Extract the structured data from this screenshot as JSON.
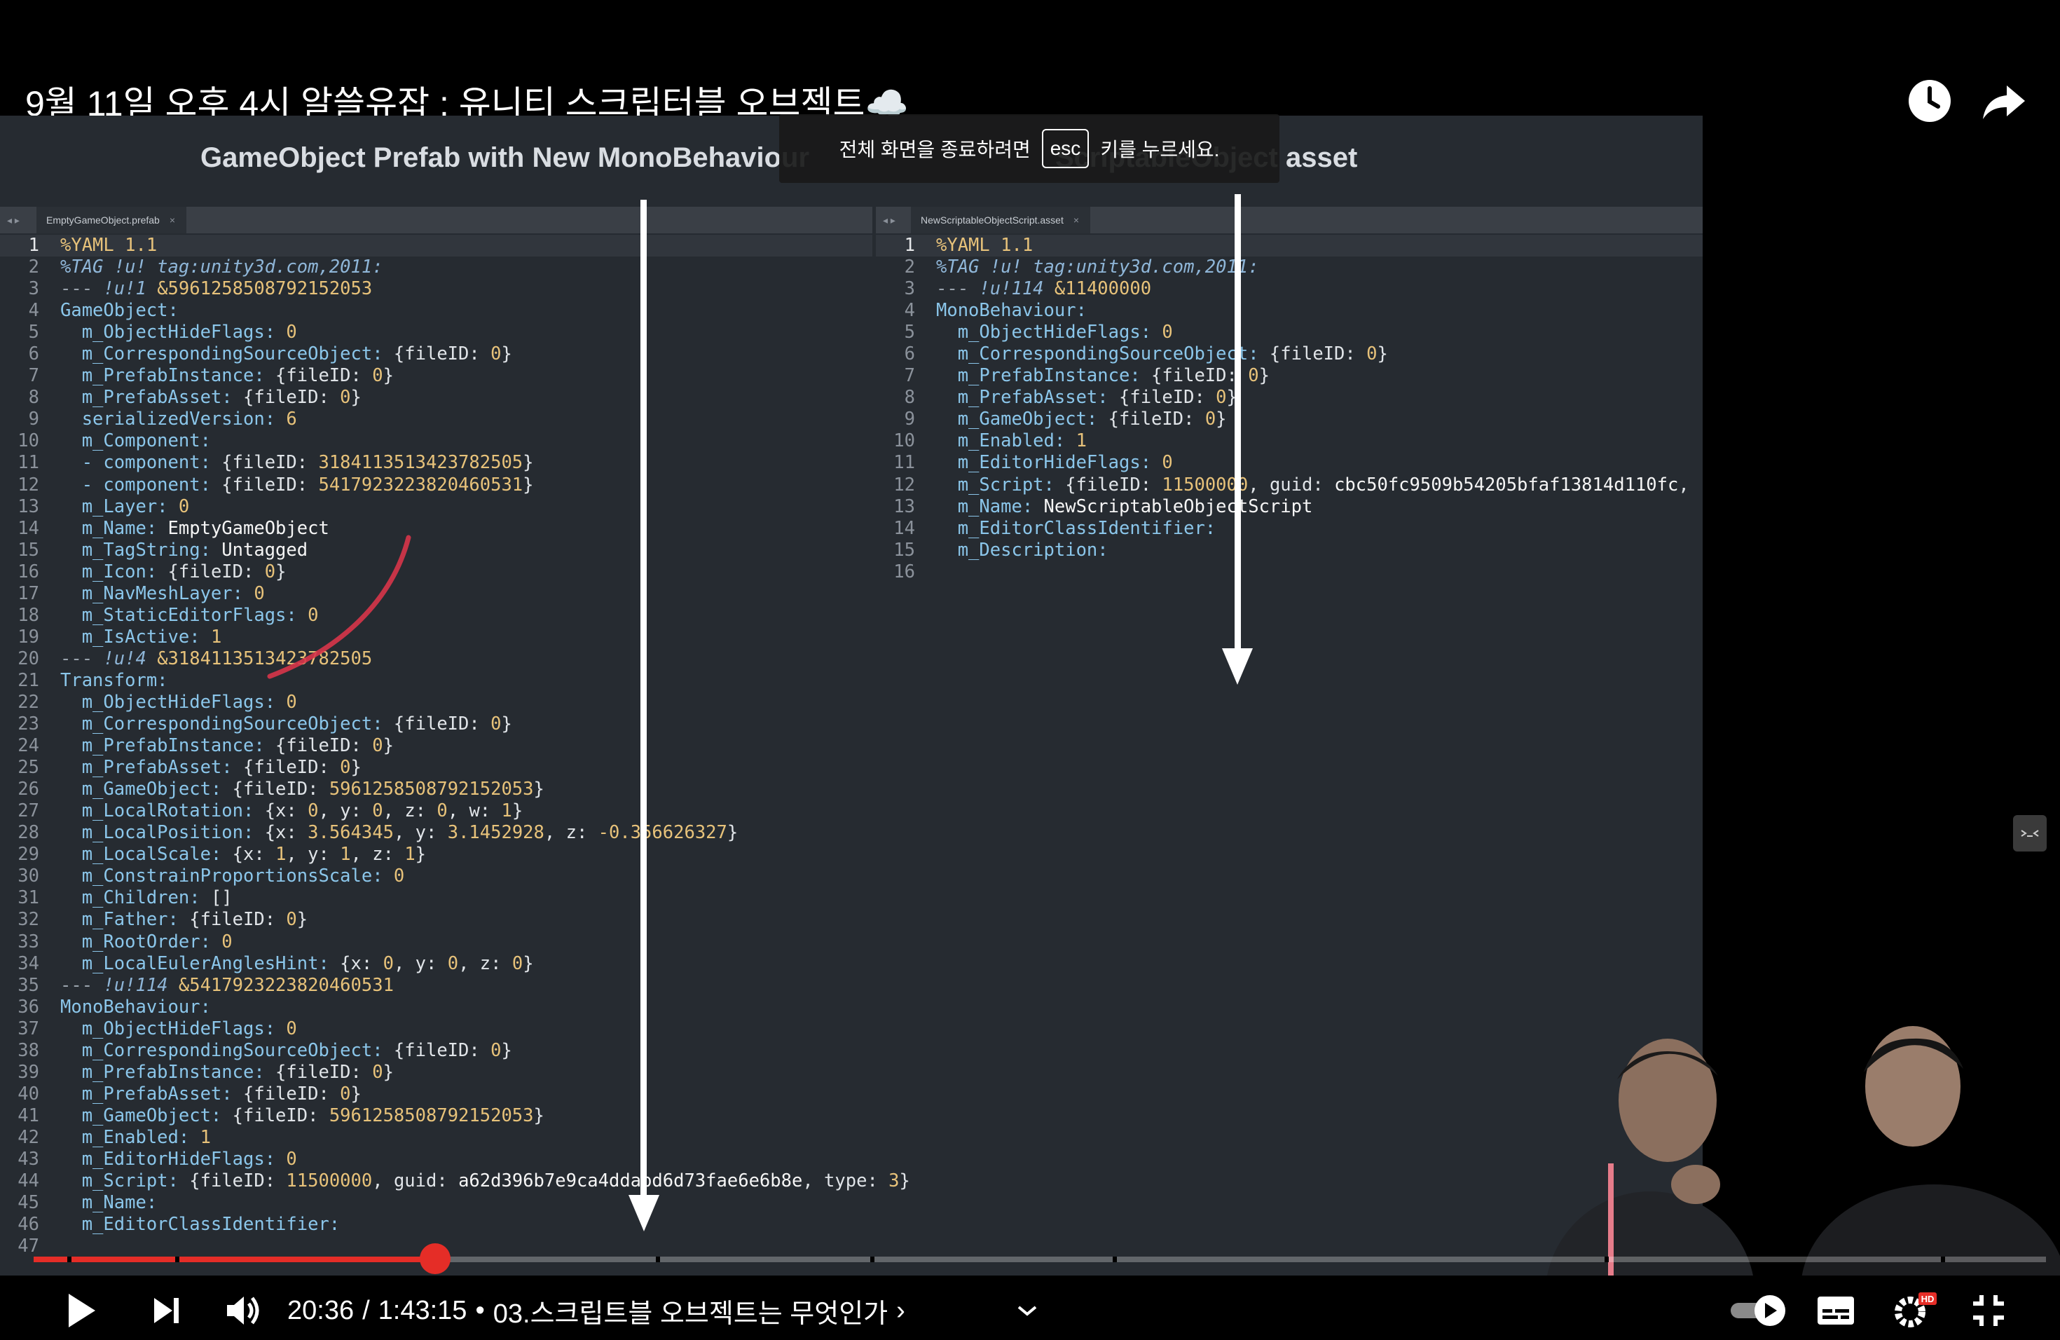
{
  "video": {
    "title": "9월 11일 오후 4시 알쓸유잡 : 유니티 스크립터블 오브젝트☁️"
  },
  "fullscreen_toast": {
    "before": "전체 화면을 종료하려면",
    "key": "esc",
    "after": "키를 누르세요."
  },
  "slide": {
    "left_heading": "GameObject Prefab with New MonoBehaviour",
    "right_heading_tail": "ScriptableObject asset",
    "left_tab": "EmptyGameObject.prefab",
    "right_tab": "NewScriptableObjectScript.asset",
    "tab_close": "×",
    "nav_arrows": "◂ ▸",
    "left_code": [
      [
        [
          "s",
          "%YAML 1.1"
        ]
      ],
      [
        [
          "c",
          "%TAG !u! tag:unity3d.com,2011:"
        ]
      ],
      [
        [
          "g",
          "--- "
        ],
        [
          "c",
          "!u!1 "
        ],
        [
          "s",
          "&5961258508792152053"
        ]
      ],
      [
        [
          "k",
          "GameObject:"
        ]
      ],
      [
        [
          "k",
          "  m_ObjectHideFlags: "
        ],
        [
          "s",
          "0"
        ]
      ],
      [
        [
          "k",
          "  m_CorrespondingSourceObject: "
        ],
        [
          "p",
          "{fileID: "
        ],
        [
          "s",
          "0"
        ],
        [
          "p",
          "}"
        ]
      ],
      [
        [
          "k",
          "  m_PrefabInstance: "
        ],
        [
          "p",
          "{fileID: "
        ],
        [
          "s",
          "0"
        ],
        [
          "p",
          "}"
        ]
      ],
      [
        [
          "k",
          "  m_PrefabAsset: "
        ],
        [
          "p",
          "{fileID: "
        ],
        [
          "s",
          "0"
        ],
        [
          "p",
          "}"
        ]
      ],
      [
        [
          "k",
          "  serializedVersion: "
        ],
        [
          "s",
          "6"
        ]
      ],
      [
        [
          "k",
          "  m_Component:"
        ]
      ],
      [
        [
          "k",
          "  - component: "
        ],
        [
          "p",
          "{fileID: "
        ],
        [
          "s",
          "3184113513423782505"
        ],
        [
          "p",
          "}"
        ]
      ],
      [
        [
          "k",
          "  - component: "
        ],
        [
          "p",
          "{fileID: "
        ],
        [
          "s",
          "5417923223820460531"
        ],
        [
          "p",
          "}"
        ]
      ],
      [
        [
          "k",
          "  m_Layer: "
        ],
        [
          "s",
          "0"
        ]
      ],
      [
        [
          "k",
          "  m_Name: "
        ],
        [
          "w",
          "EmptyGameObject"
        ]
      ],
      [
        [
          "k",
          "  m_TagString: "
        ],
        [
          "w",
          "Untagged"
        ]
      ],
      [
        [
          "k",
          "  m_Icon: "
        ],
        [
          "p",
          "{fileID: "
        ],
        [
          "s",
          "0"
        ],
        [
          "p",
          "}"
        ]
      ],
      [
        [
          "k",
          "  m_NavMeshLayer: "
        ],
        [
          "s",
          "0"
        ]
      ],
      [
        [
          "k",
          "  m_StaticEditorFlags: "
        ],
        [
          "s",
          "0"
        ]
      ],
      [
        [
          "k",
          "  m_IsActive: "
        ],
        [
          "s",
          "1"
        ]
      ],
      [
        [
          "g",
          "--- "
        ],
        [
          "c",
          "!u!4 "
        ],
        [
          "s",
          "&3184113513423782505"
        ]
      ],
      [
        [
          "k",
          "Transform:"
        ]
      ],
      [
        [
          "k",
          "  m_ObjectHideFlags: "
        ],
        [
          "s",
          "0"
        ]
      ],
      [
        [
          "k",
          "  m_CorrespondingSourceObject: "
        ],
        [
          "p",
          "{fileID: "
        ],
        [
          "s",
          "0"
        ],
        [
          "p",
          "}"
        ]
      ],
      [
        [
          "k",
          "  m_PrefabInstance: "
        ],
        [
          "p",
          "{fileID: "
        ],
        [
          "s",
          "0"
        ],
        [
          "p",
          "}"
        ]
      ],
      [
        [
          "k",
          "  m_PrefabAsset: "
        ],
        [
          "p",
          "{fileID: "
        ],
        [
          "s",
          "0"
        ],
        [
          "p",
          "}"
        ]
      ],
      [
        [
          "k",
          "  m_GameObject: "
        ],
        [
          "p",
          "{fileID: "
        ],
        [
          "s",
          "5961258508792152053"
        ],
        [
          "p",
          "}"
        ]
      ],
      [
        [
          "k",
          "  m_LocalRotation: "
        ],
        [
          "p",
          "{x: "
        ],
        [
          "s",
          "0"
        ],
        [
          "p",
          ", y: "
        ],
        [
          "s",
          "0"
        ],
        [
          "p",
          ", z: "
        ],
        [
          "s",
          "0"
        ],
        [
          "p",
          ", w: "
        ],
        [
          "s",
          "1"
        ],
        [
          "p",
          "}"
        ]
      ],
      [
        [
          "k",
          "  m_LocalPosition: "
        ],
        [
          "p",
          "{x: "
        ],
        [
          "s",
          "3.564345"
        ],
        [
          "p",
          ", y: "
        ],
        [
          "s",
          "3.1452928"
        ],
        [
          "p",
          ", z: "
        ],
        [
          "s",
          "-0.356626327"
        ],
        [
          "p",
          "}"
        ]
      ],
      [
        [
          "k",
          "  m_LocalScale: "
        ],
        [
          "p",
          "{x: "
        ],
        [
          "s",
          "1"
        ],
        [
          "p",
          ", y: "
        ],
        [
          "s",
          "1"
        ],
        [
          "p",
          ", z: "
        ],
        [
          "s",
          "1"
        ],
        [
          "p",
          "}"
        ]
      ],
      [
        [
          "k",
          "  m_ConstrainProportionsScale: "
        ],
        [
          "s",
          "0"
        ]
      ],
      [
        [
          "k",
          "  m_Children: "
        ],
        [
          "p",
          "[]"
        ]
      ],
      [
        [
          "k",
          "  m_Father: "
        ],
        [
          "p",
          "{fileID: "
        ],
        [
          "s",
          "0"
        ],
        [
          "p",
          "}"
        ]
      ],
      [
        [
          "k",
          "  m_RootOrder: "
        ],
        [
          "s",
          "0"
        ]
      ],
      [
        [
          "k",
          "  m_LocalEulerAnglesHint: "
        ],
        [
          "p",
          "{x: "
        ],
        [
          "s",
          "0"
        ],
        [
          "p",
          ", y: "
        ],
        [
          "s",
          "0"
        ],
        [
          "p",
          ", z: "
        ],
        [
          "s",
          "0"
        ],
        [
          "p",
          "}"
        ]
      ],
      [
        [
          "g",
          "--- "
        ],
        [
          "c",
          "!u!114 "
        ],
        [
          "s",
          "&5417923223820460531"
        ]
      ],
      [
        [
          "k",
          "MonoBehaviour:"
        ]
      ],
      [
        [
          "k",
          "  m_ObjectHideFlags: "
        ],
        [
          "s",
          "0"
        ]
      ],
      [
        [
          "k",
          "  m_CorrespondingSourceObject: "
        ],
        [
          "p",
          "{fileID: "
        ],
        [
          "s",
          "0"
        ],
        [
          "p",
          "}"
        ]
      ],
      [
        [
          "k",
          "  m_PrefabInstance: "
        ],
        [
          "p",
          "{fileID: "
        ],
        [
          "s",
          "0"
        ],
        [
          "p",
          "}"
        ]
      ],
      [
        [
          "k",
          "  m_PrefabAsset: "
        ],
        [
          "p",
          "{fileID: "
        ],
        [
          "s",
          "0"
        ],
        [
          "p",
          "}"
        ]
      ],
      [
        [
          "k",
          "  m_GameObject: "
        ],
        [
          "p",
          "{fileID: "
        ],
        [
          "s",
          "5961258508792152053"
        ],
        [
          "p",
          "}"
        ]
      ],
      [
        [
          "k",
          "  m_Enabled: "
        ],
        [
          "s",
          "1"
        ]
      ],
      [
        [
          "k",
          "  m_EditorHideFlags: "
        ],
        [
          "s",
          "0"
        ]
      ],
      [
        [
          "k",
          "  m_Script: "
        ],
        [
          "p",
          "{fileID: "
        ],
        [
          "s",
          "11500000"
        ],
        [
          "p",
          ", guid: "
        ],
        [
          "w",
          "a62d396b7e9ca4ddabd6d73fae6e6b8e"
        ],
        [
          "p",
          ", type: "
        ],
        [
          "s",
          "3"
        ],
        [
          "p",
          "}"
        ]
      ],
      [
        [
          "k",
          "  m_Name:"
        ]
      ],
      [
        [
          "k",
          "  m_EditorClassIdentifier:"
        ]
      ],
      []
    ],
    "right_code": [
      [
        [
          "s",
          "%YAML 1.1"
        ]
      ],
      [
        [
          "c",
          "%TAG !u! tag:unity3d.com,2011:"
        ]
      ],
      [
        [
          "g",
          "--- "
        ],
        [
          "c",
          "!u!114 "
        ],
        [
          "s",
          "&11400000"
        ]
      ],
      [
        [
          "k",
          "MonoBehaviour:"
        ]
      ],
      [
        [
          "k",
          "  m_ObjectHideFlags: "
        ],
        [
          "s",
          "0"
        ]
      ],
      [
        [
          "k",
          "  m_CorrespondingSourceObject: "
        ],
        [
          "p",
          "{fileID: "
        ],
        [
          "s",
          "0"
        ],
        [
          "p",
          "}"
        ]
      ],
      [
        [
          "k",
          "  m_PrefabInstance: "
        ],
        [
          "p",
          "{fileID: "
        ],
        [
          "s",
          "0"
        ],
        [
          "p",
          "}"
        ]
      ],
      [
        [
          "k",
          "  m_PrefabAsset: "
        ],
        [
          "p",
          "{fileID: "
        ],
        [
          "s",
          "0"
        ],
        [
          "p",
          "}"
        ]
      ],
      [
        [
          "k",
          "  m_GameObject: "
        ],
        [
          "p",
          "{fileID: "
        ],
        [
          "s",
          "0"
        ],
        [
          "p",
          "}"
        ]
      ],
      [
        [
          "k",
          "  m_Enabled: "
        ],
        [
          "s",
          "1"
        ]
      ],
      [
        [
          "k",
          "  m_EditorHideFlags: "
        ],
        [
          "s",
          "0"
        ]
      ],
      [
        [
          "k",
          "  m_Script: "
        ],
        [
          "p",
          "{fileID: "
        ],
        [
          "s",
          "11500000"
        ],
        [
          "p",
          ", guid: "
        ],
        [
          "w",
          "cbc50fc9509b54205bfaf13814d110fc"
        ],
        [
          "p",
          ","
        ]
      ],
      [
        [
          "k",
          "  m_Name: "
        ],
        [
          "w",
          "NewScriptableObjectScript"
        ]
      ],
      [
        [
          "k",
          "  m_EditorClassIdentifier:"
        ]
      ],
      [
        [
          "k",
          "  m_Description:"
        ]
      ],
      []
    ]
  },
  "player": {
    "current_time": "20:36",
    "separator": "/",
    "duration": "1:43:15",
    "chapter_bullet": "•",
    "chapter": "03.스크립트블 오브젝트는 무엇인가",
    "chapter_chevron": "›",
    "progress_fraction": 0.1995
  },
  "colors": {
    "accent": "#e52d27"
  }
}
